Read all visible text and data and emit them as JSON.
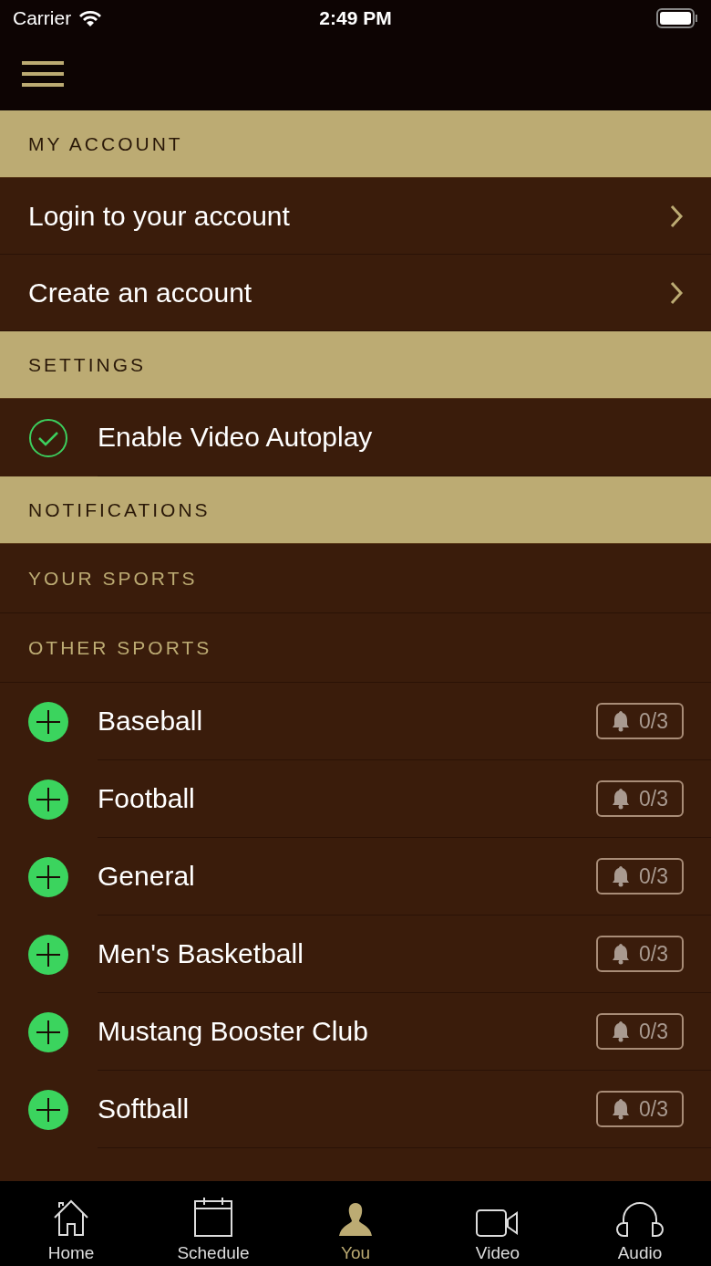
{
  "status_bar": {
    "carrier": "Carrier",
    "time": "2:49 PM"
  },
  "sections": [
    {
      "title": "MY ACCOUNT",
      "rows": [
        {
          "kind": "link",
          "label": "Login to your account"
        },
        {
          "kind": "link",
          "label": "Create an account"
        }
      ]
    },
    {
      "title": "SETTINGS",
      "rows": [
        {
          "kind": "toggle",
          "label": "Enable Video Autoplay",
          "checked": true
        }
      ]
    },
    {
      "title": "NOTIFICATIONS",
      "rows": [
        {
          "kind": "subheader",
          "label": "YOUR SPORTS"
        },
        {
          "kind": "subheader",
          "label": "OTHER SPORTS"
        },
        {
          "kind": "sport",
          "label": "Baseball",
          "count": "0/3"
        },
        {
          "kind": "sport",
          "label": "Football",
          "count": "0/3"
        },
        {
          "kind": "sport",
          "label": "General",
          "count": "0/3"
        },
        {
          "kind": "sport",
          "label": "Men's Basketball",
          "count": "0/3"
        },
        {
          "kind": "sport",
          "label": "Mustang Booster Club",
          "count": "0/3"
        },
        {
          "kind": "sport",
          "label": "Softball",
          "count": "0/3"
        }
      ]
    }
  ],
  "tabs": [
    {
      "label": "Home",
      "selected": false
    },
    {
      "label": "Schedule",
      "selected": false
    },
    {
      "label": "You",
      "selected": true
    },
    {
      "label": "Video",
      "selected": false
    },
    {
      "label": "Audio",
      "selected": false
    }
  ]
}
